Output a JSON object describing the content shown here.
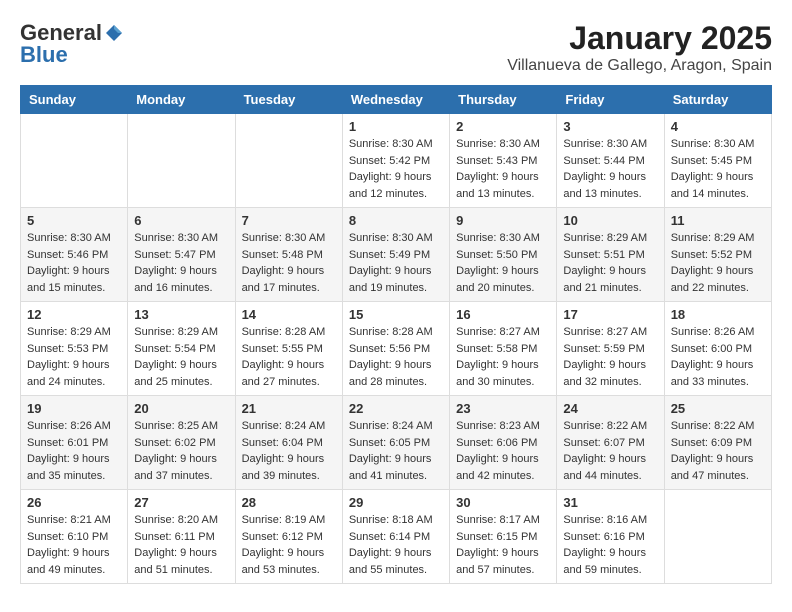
{
  "logo": {
    "general": "General",
    "blue": "Blue"
  },
  "title": "January 2025",
  "subtitle": "Villanueva de Gallego, Aragon, Spain",
  "days_of_week": [
    "Sunday",
    "Monday",
    "Tuesday",
    "Wednesday",
    "Thursday",
    "Friday",
    "Saturday"
  ],
  "weeks": [
    [
      {
        "day": "",
        "info": ""
      },
      {
        "day": "",
        "info": ""
      },
      {
        "day": "",
        "info": ""
      },
      {
        "day": "1",
        "info": "Sunrise: 8:30 AM\nSunset: 5:42 PM\nDaylight: 9 hours\nand 12 minutes."
      },
      {
        "day": "2",
        "info": "Sunrise: 8:30 AM\nSunset: 5:43 PM\nDaylight: 9 hours\nand 13 minutes."
      },
      {
        "day": "3",
        "info": "Sunrise: 8:30 AM\nSunset: 5:44 PM\nDaylight: 9 hours\nand 13 minutes."
      },
      {
        "day": "4",
        "info": "Sunrise: 8:30 AM\nSunset: 5:45 PM\nDaylight: 9 hours\nand 14 minutes."
      }
    ],
    [
      {
        "day": "5",
        "info": "Sunrise: 8:30 AM\nSunset: 5:46 PM\nDaylight: 9 hours\nand 15 minutes."
      },
      {
        "day": "6",
        "info": "Sunrise: 8:30 AM\nSunset: 5:47 PM\nDaylight: 9 hours\nand 16 minutes."
      },
      {
        "day": "7",
        "info": "Sunrise: 8:30 AM\nSunset: 5:48 PM\nDaylight: 9 hours\nand 17 minutes."
      },
      {
        "day": "8",
        "info": "Sunrise: 8:30 AM\nSunset: 5:49 PM\nDaylight: 9 hours\nand 19 minutes."
      },
      {
        "day": "9",
        "info": "Sunrise: 8:30 AM\nSunset: 5:50 PM\nDaylight: 9 hours\nand 20 minutes."
      },
      {
        "day": "10",
        "info": "Sunrise: 8:29 AM\nSunset: 5:51 PM\nDaylight: 9 hours\nand 21 minutes."
      },
      {
        "day": "11",
        "info": "Sunrise: 8:29 AM\nSunset: 5:52 PM\nDaylight: 9 hours\nand 22 minutes."
      }
    ],
    [
      {
        "day": "12",
        "info": "Sunrise: 8:29 AM\nSunset: 5:53 PM\nDaylight: 9 hours\nand 24 minutes."
      },
      {
        "day": "13",
        "info": "Sunrise: 8:29 AM\nSunset: 5:54 PM\nDaylight: 9 hours\nand 25 minutes."
      },
      {
        "day": "14",
        "info": "Sunrise: 8:28 AM\nSunset: 5:55 PM\nDaylight: 9 hours\nand 27 minutes."
      },
      {
        "day": "15",
        "info": "Sunrise: 8:28 AM\nSunset: 5:56 PM\nDaylight: 9 hours\nand 28 minutes."
      },
      {
        "day": "16",
        "info": "Sunrise: 8:27 AM\nSunset: 5:58 PM\nDaylight: 9 hours\nand 30 minutes."
      },
      {
        "day": "17",
        "info": "Sunrise: 8:27 AM\nSunset: 5:59 PM\nDaylight: 9 hours\nand 32 minutes."
      },
      {
        "day": "18",
        "info": "Sunrise: 8:26 AM\nSunset: 6:00 PM\nDaylight: 9 hours\nand 33 minutes."
      }
    ],
    [
      {
        "day": "19",
        "info": "Sunrise: 8:26 AM\nSunset: 6:01 PM\nDaylight: 9 hours\nand 35 minutes."
      },
      {
        "day": "20",
        "info": "Sunrise: 8:25 AM\nSunset: 6:02 PM\nDaylight: 9 hours\nand 37 minutes."
      },
      {
        "day": "21",
        "info": "Sunrise: 8:24 AM\nSunset: 6:04 PM\nDaylight: 9 hours\nand 39 minutes."
      },
      {
        "day": "22",
        "info": "Sunrise: 8:24 AM\nSunset: 6:05 PM\nDaylight: 9 hours\nand 41 minutes."
      },
      {
        "day": "23",
        "info": "Sunrise: 8:23 AM\nSunset: 6:06 PM\nDaylight: 9 hours\nand 42 minutes."
      },
      {
        "day": "24",
        "info": "Sunrise: 8:22 AM\nSunset: 6:07 PM\nDaylight: 9 hours\nand 44 minutes."
      },
      {
        "day": "25",
        "info": "Sunrise: 8:22 AM\nSunset: 6:09 PM\nDaylight: 9 hours\nand 47 minutes."
      }
    ],
    [
      {
        "day": "26",
        "info": "Sunrise: 8:21 AM\nSunset: 6:10 PM\nDaylight: 9 hours\nand 49 minutes."
      },
      {
        "day": "27",
        "info": "Sunrise: 8:20 AM\nSunset: 6:11 PM\nDaylight: 9 hours\nand 51 minutes."
      },
      {
        "day": "28",
        "info": "Sunrise: 8:19 AM\nSunset: 6:12 PM\nDaylight: 9 hours\nand 53 minutes."
      },
      {
        "day": "29",
        "info": "Sunrise: 8:18 AM\nSunset: 6:14 PM\nDaylight: 9 hours\nand 55 minutes."
      },
      {
        "day": "30",
        "info": "Sunrise: 8:17 AM\nSunset: 6:15 PM\nDaylight: 9 hours\nand 57 minutes."
      },
      {
        "day": "31",
        "info": "Sunrise: 8:16 AM\nSunset: 6:16 PM\nDaylight: 9 hours\nand 59 minutes."
      },
      {
        "day": "",
        "info": ""
      }
    ]
  ]
}
